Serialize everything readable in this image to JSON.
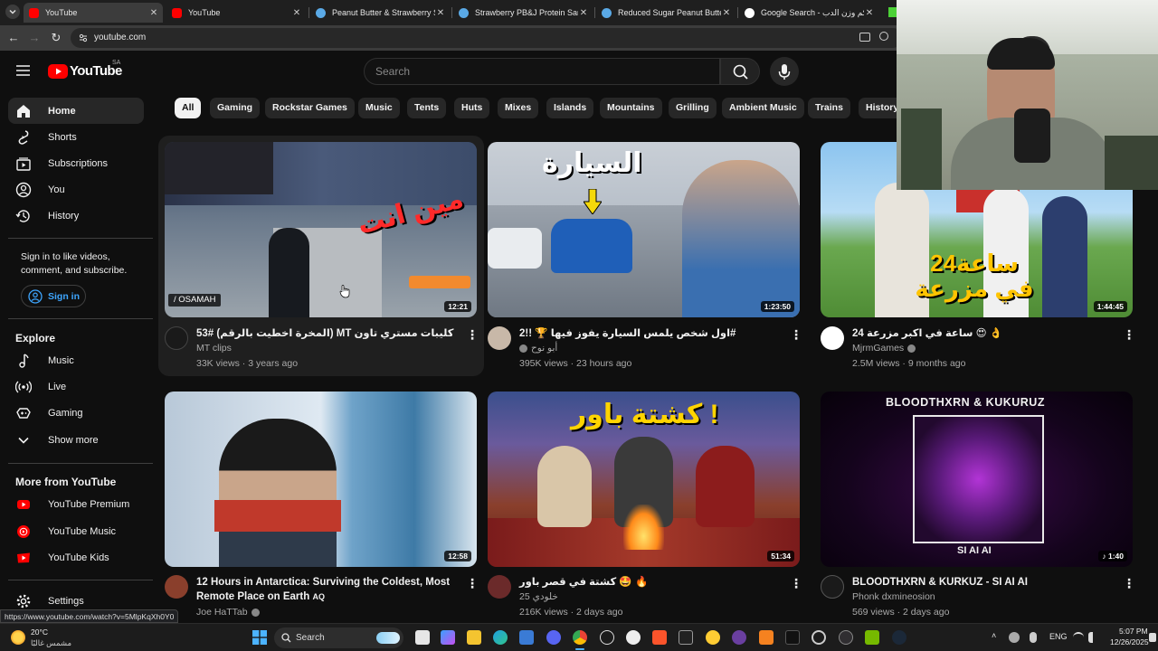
{
  "browser": {
    "tabs": [
      {
        "title": "YouTube",
        "favicon_color": "#ff0000",
        "active": true
      },
      {
        "title": "YouTube",
        "favicon_color": "#ff0000",
        "active": false
      },
      {
        "title": "Peanut Butter & Strawberry Sp",
        "favicon_color": "#5aa9e6",
        "active": false
      },
      {
        "title": "Strawberry PB&J Protein Sandw",
        "favicon_color": "#5aa9e6",
        "active": false
      },
      {
        "title": "Reduced Sugar Peanut Butter &",
        "favicon_color": "#5aa9e6",
        "active": false
      },
      {
        "title": "Google Search - كم وزن الدب",
        "favicon_color": "#ffffff",
        "active": false
      }
    ],
    "url": "youtube.com",
    "status_url": "https://www.youtube.com/watch?v=5MlpKqXh0Y0"
  },
  "masthead": {
    "logo_text": "YouTube",
    "region": "SA",
    "search_placeholder": "Search"
  },
  "sidebar": {
    "main": [
      {
        "label": "Home",
        "icon": "home-icon",
        "selected": true
      },
      {
        "label": "Shorts",
        "icon": "shorts-icon"
      },
      {
        "label": "Subscriptions",
        "icon": "subscriptions-icon"
      },
      {
        "label": "You",
        "icon": "you-icon"
      },
      {
        "label": "History",
        "icon": "history-icon"
      }
    ],
    "signin_text": "Sign in to like videos, comment, and subscribe.",
    "signin_button": "Sign in",
    "explore_heading": "Explore",
    "explore": [
      {
        "label": "Music",
        "icon": "music-icon"
      },
      {
        "label": "Live",
        "icon": "live-icon"
      },
      {
        "label": "Gaming",
        "icon": "gaming-icon"
      },
      {
        "label": "Show more",
        "icon": "chevron-down-icon"
      }
    ],
    "more_heading": "More from YouTube",
    "more": [
      {
        "label": "YouTube Premium",
        "icon": "youtube-premium-icon"
      },
      {
        "label": "YouTube Music",
        "icon": "youtube-music-icon"
      },
      {
        "label": "YouTube Kids",
        "icon": "youtube-kids-icon"
      }
    ],
    "settings": "Settings"
  },
  "chips": [
    "All",
    "Gaming",
    "Rockstar Games",
    "Music",
    "Tents",
    "Huts",
    "Mixes",
    "Islands",
    "Mountains",
    "Grilling",
    "Ambient Music",
    "Trains",
    "History"
  ],
  "videos": [
    {
      "title": "53# (المخرة اخطيت بالرقم) MT كليبات مستري تاون",
      "channel": "MT clips",
      "views": "33K views",
      "age": "3 years ago",
      "duration": "12:21",
      "verified": false,
      "thumb_overlay": "OSAMAH",
      "thumb_overlay2": "مين انت"
    },
    {
      "title": "اول شخص يلمس السيارة يفوز فيها 🏆 !!2#",
      "channel": "أبو نوح",
      "views": "395K views",
      "age": "23 hours ago",
      "duration": "1:23:50",
      "verified": true,
      "thumb_overlay": "السيارة"
    },
    {
      "title": "24 ساعة في اكبر مزرعة 😍 👌",
      "channel": "MjrmGames",
      "views": "2.5M views",
      "age": "9 months ago",
      "duration": "1:44:45",
      "verified": true,
      "thumb_overlay": "24ساعة في مزرعة"
    },
    {
      "title": "12 Hours in Antarctica: Surviving the Coldest, Most Remote Place on Earth",
      "title_badge": "AQ",
      "channel": "Joe HaTTab",
      "views": "",
      "age": "",
      "duration": "12:58",
      "verified": true
    },
    {
      "title": "كشتة في قصر باور 🤩 🔥",
      "channel": "خلودي 25",
      "views": "216K views",
      "age": "2 days ago",
      "duration": "51:34",
      "verified": false,
      "thumb_overlay": "كشتة باور !"
    },
    {
      "title": "BLOODTHXRN & KURKUZ - SI AI AI",
      "channel": "Phonk dxmineosion",
      "views": "569 views",
      "age": "2 days ago",
      "duration": "1:40",
      "verified": false,
      "thumb_overlay": "BLOODTHXRN & KUKURUZ",
      "thumb_overlay2": "SI AI AI"
    }
  ],
  "taskbar": {
    "weather_temp": "20°C",
    "weather_desc": "مشمس غالبًا",
    "search_label": "Search",
    "lang": "ENG",
    "time": "5:07 PM",
    "date": "12/26/2025"
  },
  "colors": {
    "accent_red": "#ff0000",
    "signin_blue": "#3ea6ff",
    "background": "#0f0f0f"
  }
}
